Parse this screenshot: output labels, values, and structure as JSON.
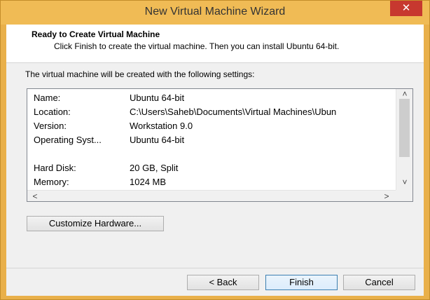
{
  "window": {
    "title": "New Virtual Machine Wizard",
    "close_label": "✕"
  },
  "header": {
    "title": "Ready to Create Virtual Machine",
    "subtitle": "Click Finish to create the virtual machine. Then you can install Ubuntu 64-bit."
  },
  "intro_text": "The virtual machine will be created with the following settings:",
  "settings": [
    {
      "key": "Name:",
      "value": "Ubuntu 64-bit"
    },
    {
      "key": "Location:",
      "value": "C:\\Users\\Saheb\\Documents\\Virtual Machines\\Ubun"
    },
    {
      "key": "Version:",
      "value": "Workstation 9.0"
    },
    {
      "key": "Operating Syst...",
      "value": "Ubuntu 64-bit"
    },
    {
      "key": "Hard Disk:",
      "value": "20 GB, Split"
    },
    {
      "key": "Memory:",
      "value": "1024 MB"
    }
  ],
  "scroll": {
    "up": "˄",
    "down": "˅",
    "left": "<",
    "right": ">"
  },
  "buttons": {
    "customize": "Customize Hardware...",
    "back": "< Back",
    "finish": "Finish",
    "cancel": "Cancel"
  },
  "colors": {
    "title_bar": "#f0bb55",
    "close": "#c7382f",
    "default_button_border": "#3c7fb1"
  }
}
